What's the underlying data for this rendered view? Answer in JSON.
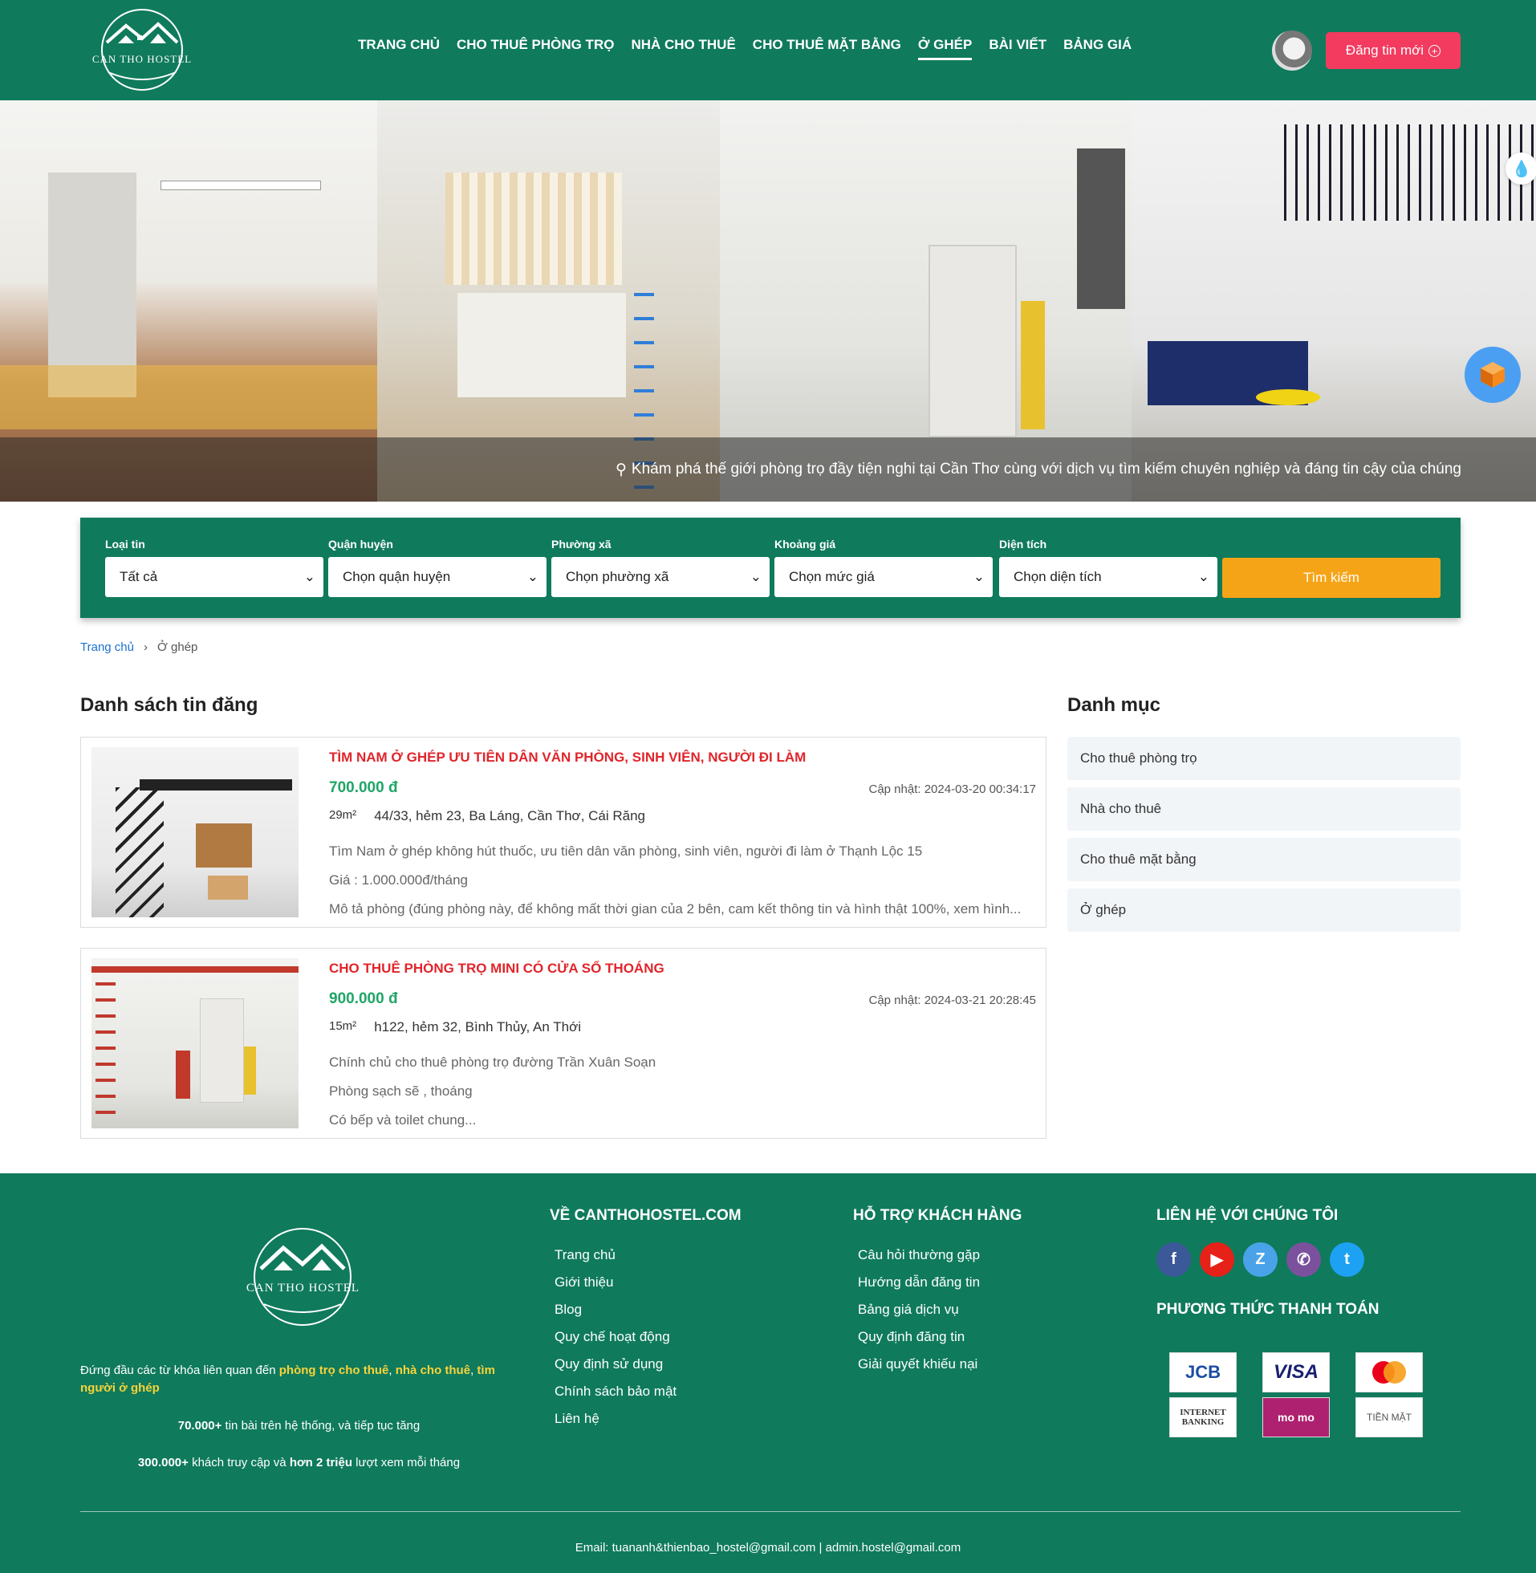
{
  "header": {
    "logo_text": "CAN THO HOSTEL",
    "nav": [
      "TRANG CHỦ",
      "CHO THUÊ PHÒNG TRỌ",
      "NHÀ CHO THUÊ",
      "CHO THUÊ MẶT BẰNG",
      "Ở GHÉP",
      "BÀI VIẾT",
      "BẢNG GIÁ"
    ],
    "active_nav": "Ở GHÉP",
    "post_button": "Đăng tin mới"
  },
  "hero": {
    "caption": "Khám phá thế giới phòng trọ đầy tiện nghi tại Cần Thơ cùng với dịch vụ tìm kiếm chuyên nghiệp và đáng tin cậy của chúng"
  },
  "search": {
    "fields": [
      {
        "label": "Loại tin",
        "value": "Tất cả"
      },
      {
        "label": "Quận huyện",
        "value": "Chọn quận huyện"
      },
      {
        "label": "Phường xã",
        "value": "Chọn phường xã"
      },
      {
        "label": "Khoảng giá",
        "value": "Chọn mức giá"
      },
      {
        "label": "Diện tích",
        "value": "Chọn diện tích"
      }
    ],
    "button": "Tìm kiếm"
  },
  "breadcrumb": {
    "home": "Trang chủ",
    "current": "Ở ghép"
  },
  "listings_title": "Danh sách tin đăng",
  "listings": [
    {
      "title": "TÌM NAM Ở GHÉP ƯU TIÊN DÂN VĂN PHÒNG, SINH VIÊN, NGƯỜI ĐI LÀM",
      "price": "700.000 đ",
      "updated": "Cập nhật: 2024-03-20 00:34:17",
      "area": "29m²",
      "address": "44/33, hẻm 23, Ba Láng, Cần Thơ, Cái Răng",
      "desc": [
        "Tìm Nam ở ghép không hút thuốc, ưu tiên dân văn phòng, sinh viên, người đi làm ở Thạnh Lộc 15",
        "Giá : 1.000.000đ/tháng",
        "Mô tả phòng (đúng phòng này, để không mất thời gian của 2 bên, cam kết thông tin và hình thật 100%, xem hình..."
      ]
    },
    {
      "title": "CHO THUÊ PHÒNG TRỌ MINI CÓ CỬA SỔ THOÁNG",
      "price": "900.000 đ",
      "updated": "Cập nhật: 2024-03-21 20:28:45",
      "area": "15m²",
      "address": "h122, hẻm 32, Bình Thủy, An Thới",
      "desc": [
        "Chính chủ cho thuê phòng trọ đường Trần Xuân Soạn",
        "Phòng sạch sẽ , thoáng",
        "Có bếp và toilet chung..."
      ]
    }
  ],
  "categories_title": "Danh mục",
  "categories": [
    "Cho thuê phòng trọ",
    "Nhà cho thuê",
    "Cho thuê mặt bằng",
    "Ở ghép"
  ],
  "footer": {
    "logo_text": "CAN THO HOSTEL",
    "desc_prefix": "Đứng đầu các từ khóa liên quan đến ",
    "kw1": "phòng trọ cho thuê",
    "kw2": "nhà cho thuê",
    "kw3": "tìm người ở ghép",
    "stat1_bold": "70.000+",
    "stat1_rest": " tin bài trên hệ thống, và tiếp tục tăng",
    "stat2_bold": "300.000+",
    "stat2_mid": " khách truy cập và ",
    "stat2_bold2": "hơn 2 triệu",
    "stat2_rest": " lượt xem mỗi tháng",
    "about_title": "VỀ CANTHOHOSTEL.COM",
    "about_links": [
      "Trang chủ",
      "Giới thiệu",
      "Blog",
      "Quy chế hoạt động",
      "Quy định sử dụng",
      "Chính sách bảo mật",
      "Liên hệ"
    ],
    "support_title": "HỖ TRỢ KHÁCH HÀNG",
    "support_links": [
      "Câu hỏi thường gặp",
      "Hướng dẫn đăng tin",
      "Bảng giá dịch vụ",
      "Quy định đăng tin",
      "Giải quyết khiếu nại"
    ],
    "contact_title": "LIÊN HỆ VỚI CHÚNG TÔI",
    "payment_title": "PHƯƠNG THỨC THANH TOÁN",
    "payments": [
      "JCB",
      "VISA",
      "",
      "INTERNET BANKING",
      "mo mo",
      "TIỀN MẶT"
    ],
    "email": "Email: tuananh&thienbao_hostel@gmail.com | admin.hostel@gmail.com"
  },
  "colors": {
    "primary": "#0f7a5c",
    "accent_red": "#e0252b",
    "price_green": "#1fa567",
    "button_orange": "#f6a417",
    "post_pink": "#f23b5f"
  }
}
